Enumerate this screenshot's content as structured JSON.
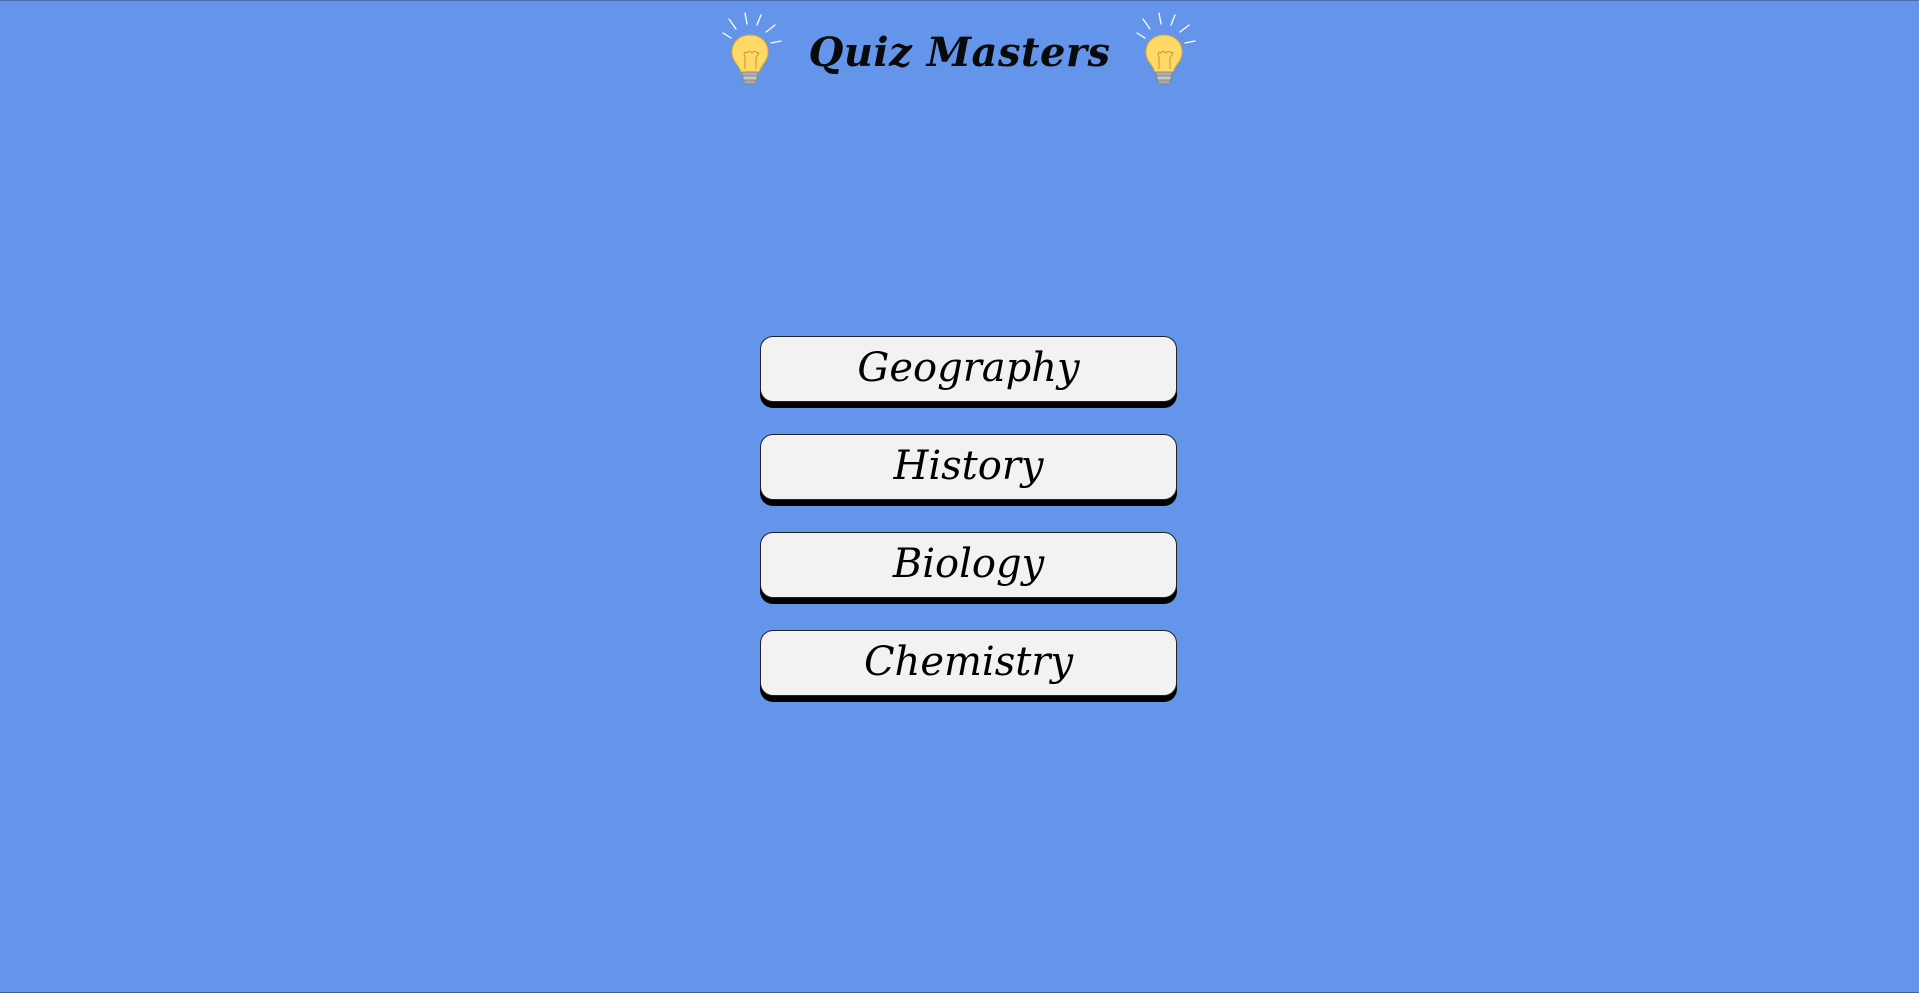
{
  "app": {
    "title": "Quiz Masters",
    "icon": "lightbulb-icon"
  },
  "menu": {
    "items": [
      {
        "label": "Geography"
      },
      {
        "label": "History"
      },
      {
        "label": "Biology"
      },
      {
        "label": "Chemistry"
      }
    ]
  },
  "colors": {
    "background": "#6495ea",
    "button_face": "#f2f2f2",
    "button_shadow": "#000000",
    "bulb": "#ffd966"
  }
}
